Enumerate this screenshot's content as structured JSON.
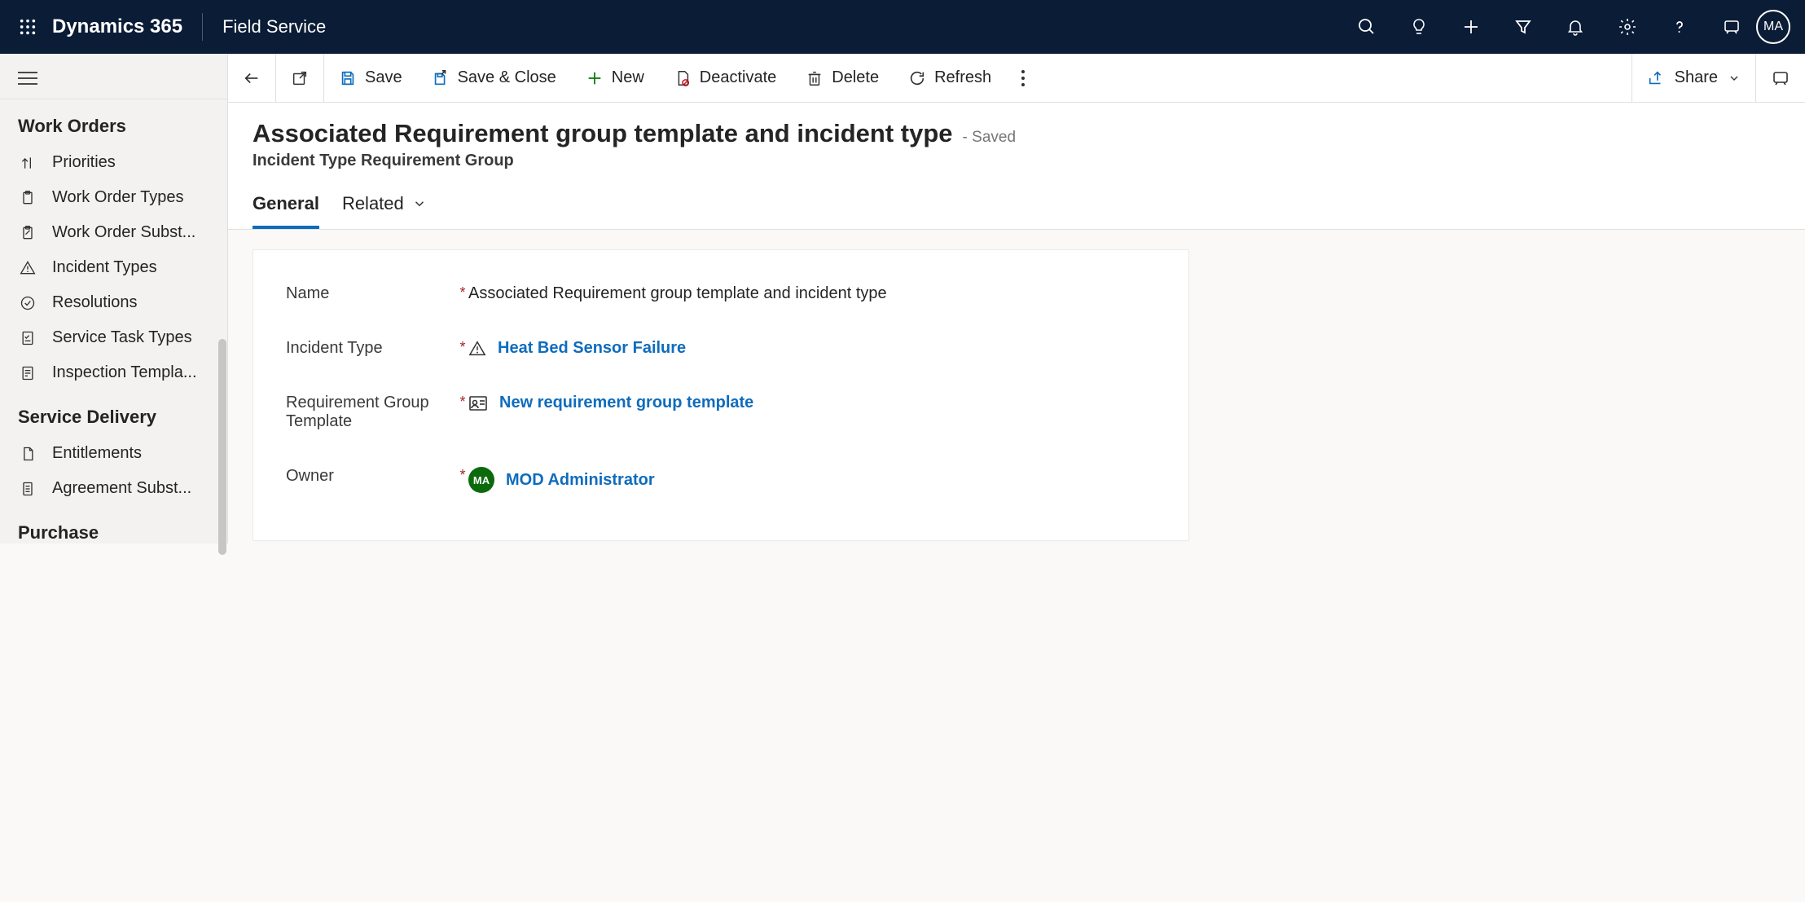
{
  "topnav": {
    "brand": "Dynamics 365",
    "module": "Field Service",
    "avatar": "MA"
  },
  "sidebar": {
    "sections": [
      {
        "title": "Work Orders",
        "items": [
          {
            "label": "Priorities"
          },
          {
            "label": "Work Order Types"
          },
          {
            "label": "Work Order Subst..."
          },
          {
            "label": "Incident Types"
          },
          {
            "label": "Resolutions"
          },
          {
            "label": "Service Task Types"
          },
          {
            "label": "Inspection Templa..."
          }
        ]
      },
      {
        "title": "Service Delivery",
        "items": [
          {
            "label": "Entitlements"
          },
          {
            "label": "Agreement Subst..."
          }
        ]
      },
      {
        "title": "Purchase",
        "items": []
      }
    ]
  },
  "commandbar": {
    "save": "Save",
    "saveclose": "Save & Close",
    "new": "New",
    "deactivate": "Deactivate",
    "delete": "Delete",
    "refresh": "Refresh",
    "share": "Share"
  },
  "page": {
    "title": "Associated Requirement group template and incident type",
    "save_status": "- Saved",
    "entity_name": "Incident Type Requirement Group"
  },
  "tabs": {
    "general": "General",
    "related": "Related"
  },
  "form": {
    "name": {
      "label": "Name",
      "value": "Associated Requirement group template and incident type"
    },
    "incident_type": {
      "label": "Incident Type",
      "value": "Heat Bed Sensor Failure"
    },
    "req_group_template": {
      "label": "Requirement Group Template",
      "value": "New requirement group template"
    },
    "owner": {
      "label": "Owner",
      "value": "MOD Administrator",
      "avatar": "MA"
    }
  }
}
